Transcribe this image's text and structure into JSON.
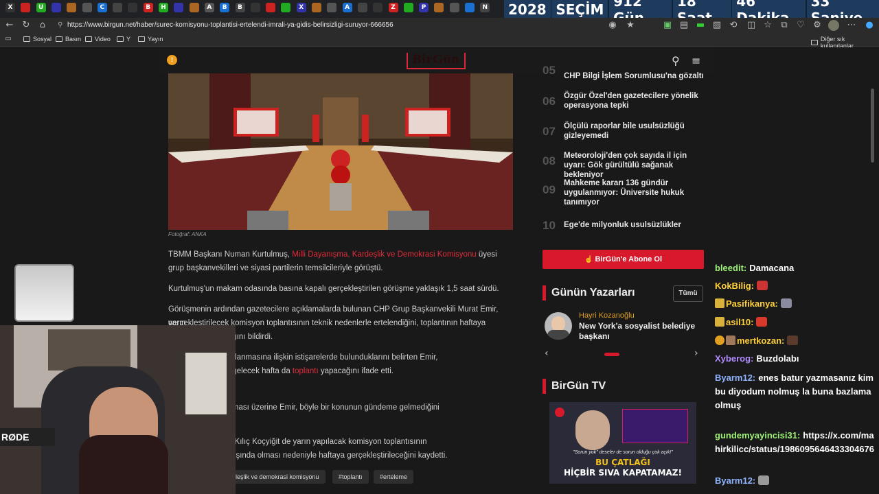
{
  "browser": {
    "url": "https://www.birgun.net/haber/surec-komisyonu-toplantisi-ertelendi-imrali-ya-gidis-belirsizligi-suruyor-666656",
    "tabs": [
      "X",
      "",
      "U",
      "",
      "",
      "",
      "C",
      "",
      "",
      "B",
      "H",
      "",
      "",
      "A",
      "B",
      "B",
      "",
      "",
      "",
      "X",
      "",
      "",
      "A",
      "",
      "",
      "Z",
      "",
      "P",
      "",
      "",
      "",
      "N"
    ],
    "bookmarks": [
      "Sosyal",
      "Basın",
      "Video",
      "Y",
      "Yayın"
    ],
    "other_bookmarks": "Diğer sık kullanılanlar"
  },
  "countdown": {
    "year": "2028",
    "label": "SEÇİM",
    "days": "912 Gün",
    "hours": "18 Saat",
    "minutes": "46 Dakika",
    "seconds": "33 Saniye"
  },
  "site": {
    "logo": "BirGün"
  },
  "article": {
    "photo_credit": "Fotoğraf: ANKA",
    "p1_before": "TBMM Başkanı Numan Kurtulmuş, ",
    "p1_link": "Milli Dayanışma, Kardeşlik ve Demokrasi Komisyonu",
    "p1_after": " üyesi grup başkanvekilleri ve siyasi partilerin temsilcileriyle görüştü.",
    "p2": "Kurtulmuş'un makam odasında basına kapalı gerçekleştirilen görüşme yaklaşık 1,5 saat sürdü.",
    "p3a": "Görüşmenin ardından gazetecilere açıklamalarda bulunan CHP Grup Başkanvekili Murat Emir, yarın",
    "p3b": "gerçekleştirilecek komisyon toplantısının teknik nedenlerle ertelendiğini, toplantının haftaya",
    "p3c": "lmasının planlandığını bildirdi.",
    "p4a": "on raporunun hazırlanmasına ilişkin istişarelerde bulunduklarını belirten Emir,",
    "p4b_before": "başkanvekilleriyle gelecek hafta da ",
    "p4b_link": "toplantı",
    "p4b_after": " yapacağını ifade etti.",
    "subheading": "Ş BELİRSİZ",
    "p5": "lmeyeceğini\" sorulması üzerine Emir, böyle bir konunun gündeme gelmediğini",
    "p6a": "kanvekili Gülüstan Kılıç Koçyiğit de yarın yapılacak komisyon toplantısının",
    "p6b": "n bakanların yurt dışında olması nedeniyle haftaya gerçekleştirileceğini kaydetti.",
    "tags": [
      "leşlik ve demokrasi komisyonu",
      "#toplantı",
      "#erteleme"
    ]
  },
  "most_read": [
    {
      "num": "05",
      "title": "CHP Bilgi İşlem Sorumlusu'na gözaltı"
    },
    {
      "num": "06",
      "title": "Özgür Özel'den gazetecilere yönelik operasyona tepki"
    },
    {
      "num": "07",
      "title": "Ölçülü raporlar bile usulsüzlüğü gizleyemedi"
    },
    {
      "num": "08",
      "title": "Meteoroloji'den çok sayıda il için uyarı: Gök gürültülü sağanak bekleniyor"
    },
    {
      "num": "09",
      "title": "Mahkeme kararı 136 gündür uygulanmıyor: Üniversite hukuk tanımıyor"
    },
    {
      "num": "10",
      "title": "Ege'de milyonluk usulsüzlükler"
    }
  ],
  "subscribe_label": "BirGün'e Abone Ol",
  "writers": {
    "title": "Günün Yazarları",
    "all_button": "Tümü",
    "author": "Hayri Kozanoğlu",
    "headline": "New York'a sosyalist belediye başkanı"
  },
  "tv": {
    "title": "BirGün TV",
    "quote": "\"Sorun yok\" deseler de sorun olduğu çok açık!\"",
    "headline1": "BU ÇATLAĞI",
    "headline2": "HİÇBİR SIVA KAPATAMAZ!"
  },
  "chat": [
    {
      "user": "bleedit:",
      "msg": "Damacana",
      "color": "#9ef27a"
    },
    {
      "user": "KokBilig:",
      "msg": "",
      "color": "#ffcf3a"
    },
    {
      "user": "Pasifikanya:",
      "msg": "",
      "color": "#ffcf3a"
    },
    {
      "user": "asil10:",
      "msg": "",
      "color": "#ffcf3a"
    },
    {
      "user": "mertkozan:",
      "msg": "",
      "color": "#ffcf3a"
    },
    {
      "user": "Xyberog:",
      "msg": "Buzdolabı",
      "color": "#b58cff"
    },
    {
      "user": "Byarm12:",
      "msg": "enes batur yazmasanız kim bu diyodum nolmuş la buna bazlama olmuş",
      "color": "#8fb4ff"
    },
    {
      "user": "gundemyayincisi31:",
      "msg": "https://x.com/mahirkilicc/status/1986095646433304676",
      "color": "#9ef27a"
    },
    {
      "user": "Byarm12:",
      "msg": "",
      "color": "#8fb4ff"
    }
  ],
  "webcam": {
    "mic_label": "RØDE"
  },
  "colors": {
    "accent": "#d8192c",
    "countdown_bg": "#1e3a5c"
  }
}
